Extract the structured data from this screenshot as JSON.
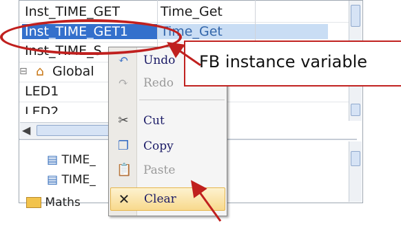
{
  "table": {
    "rows": [
      {
        "name": "Inst_TIME_GET",
        "type": "Time_Get"
      },
      {
        "name": "Inst_TIME_GET1",
        "type": "Time_Get"
      },
      {
        "name": "Inst_TIME_S"
      },
      {
        "name": "Global"
      },
      {
        "name": "LED1"
      },
      {
        "name": "LED2"
      }
    ]
  },
  "tree": {
    "items": [
      {
        "label": "TIME_",
        "icon": "function-block-icon"
      },
      {
        "label": "TIME_",
        "icon": "function-block-icon"
      },
      {
        "label": "Maths",
        "icon": "folder-icon"
      }
    ]
  },
  "context_menu": {
    "items": [
      {
        "label": "Undo",
        "icon": "undo-icon",
        "enabled": true
      },
      {
        "label": "Redo",
        "icon": "redo-icon",
        "enabled": false
      },
      {
        "label": "Cut",
        "icon": "scissors-icon",
        "enabled": true
      },
      {
        "label": "Copy",
        "icon": "copy-icon",
        "enabled": true
      },
      {
        "label": "Paste",
        "icon": "paste-icon",
        "enabled": false
      },
      {
        "label": "Clear",
        "icon": "close-x-icon",
        "enabled": true,
        "highlighted": true
      }
    ]
  },
  "annotation": {
    "callout_text": "FB instance variable",
    "color": "#c0201e"
  },
  "colors": {
    "selection": "#3470cc",
    "menu_hover": "#f8d98d"
  }
}
